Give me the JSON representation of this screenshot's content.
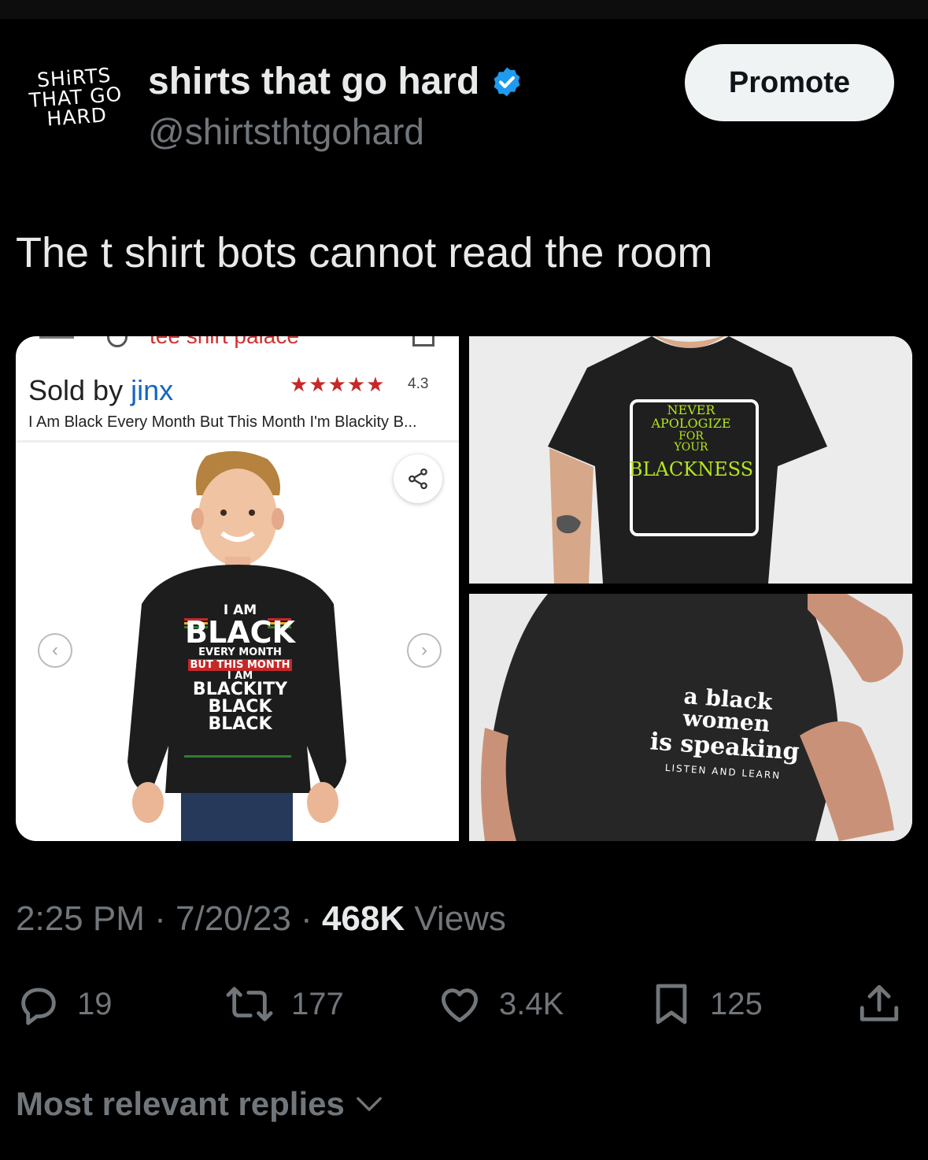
{
  "account": {
    "avatar_text": [
      "SHiRTS",
      "THAT GO",
      "HARD"
    ],
    "display_name": "shirts that go hard",
    "handle": "@shirtsthtgohard",
    "promote_label": "Promote"
  },
  "tweet": {
    "text": "The t shirt bots cannot read the room"
  },
  "media": {
    "shop": {
      "store_name": "tee shirt palace",
      "sold_by_prefix": "Sold by",
      "seller": "jinx",
      "stars": "★★★★★",
      "rating": "4.3",
      "product_title": "I Am Black Every Month But This Month I'm Blackity B...",
      "shirt_lines": [
        "I AM",
        "BLACK",
        "EVERY MONTH",
        "BUT THIS MONTH",
        "I AM",
        "BLACKITY",
        "BLACK",
        "BLACK"
      ]
    },
    "shirt_a_lines": [
      "NEVER",
      "APOLOGIZE",
      "FOR",
      "YOUR",
      "BLACKNESS"
    ],
    "shirt_b_lines": [
      "a black",
      "women",
      "is speaking",
      "LISTEN AND LEARN"
    ]
  },
  "meta": {
    "time": "2:25 PM",
    "date": "7/20/23",
    "views_count": "468K",
    "views_label": "Views"
  },
  "actions": {
    "replies": "19",
    "reposts": "177",
    "likes": "3.4K",
    "bookmarks": "125"
  },
  "replies_sort": "Most relevant replies",
  "colors": {
    "background": "#000000",
    "verified": "#1d9bf0",
    "muted_text": "#71767b",
    "primary_text": "#e7e9ea"
  }
}
